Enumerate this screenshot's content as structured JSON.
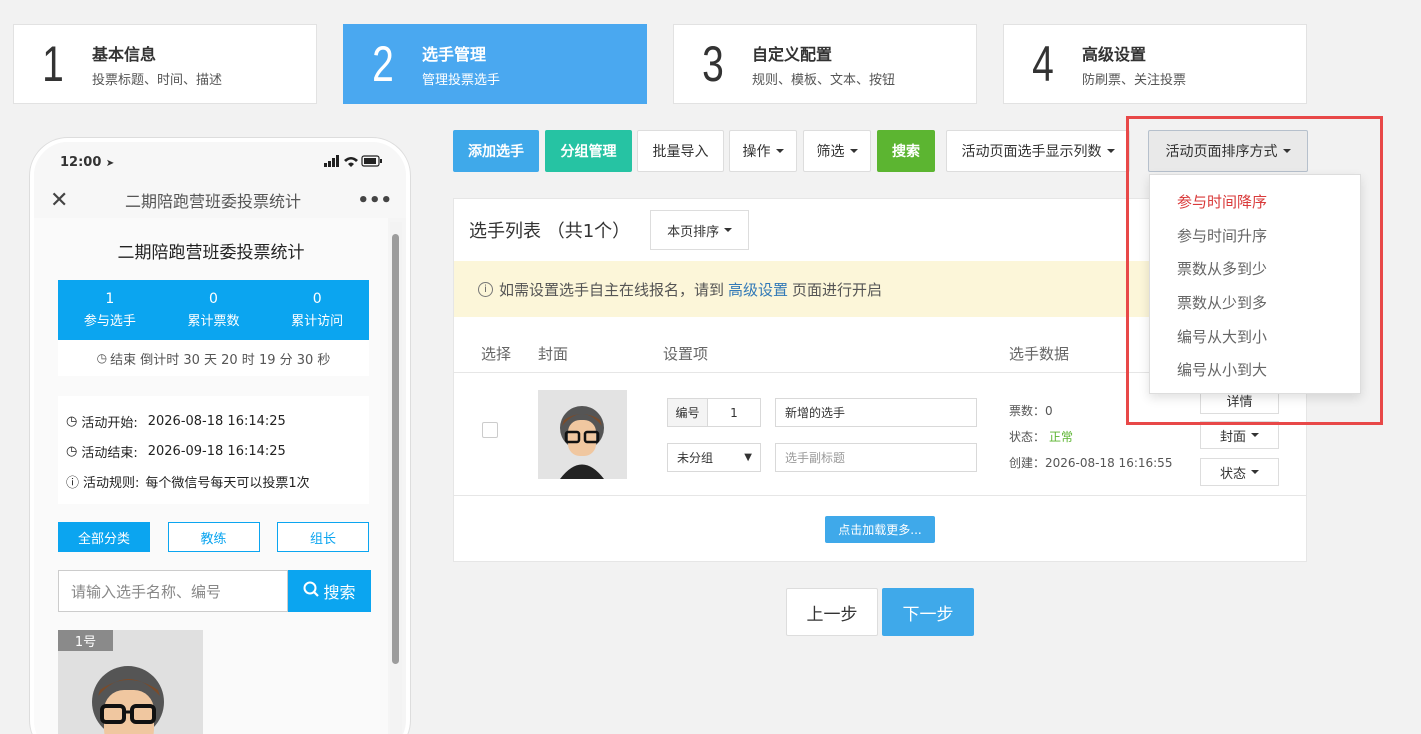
{
  "steps": [
    {
      "num": "1",
      "title": "基本信息",
      "sub": "投票标题、时间、描述"
    },
    {
      "num": "2",
      "title": "选手管理",
      "sub": "管理投票选手"
    },
    {
      "num": "3",
      "title": "自定义配置",
      "sub": "规则、模板、文本、按钮"
    },
    {
      "num": "4",
      "title": "高级设置",
      "sub": "防刷票、关注投票"
    }
  ],
  "phone": {
    "time": "12:00",
    "nav_title": "二期陪跑营班委投票统计",
    "page_title": "二期陪跑营班委投票统计",
    "stats": [
      {
        "value": "1",
        "label": "参与选手"
      },
      {
        "value": "0",
        "label": "累计票数"
      },
      {
        "value": "0",
        "label": "累计访问"
      }
    ],
    "countdown": "结束 倒计时 30 天 20 时 19 分 30 秒",
    "info": [
      {
        "label": "活动开始:",
        "value": "2026-08-18 16:14:25"
      },
      {
        "label": "活动结束:",
        "value": "2026-09-18 16:14:25"
      },
      {
        "label": "活动规则:",
        "value": "每个微信号每天可以投票1次"
      }
    ],
    "tabs": [
      "全部分类",
      "教练",
      "组长"
    ],
    "search_placeholder": "请输入选手名称、编号",
    "search_button": "搜索",
    "card_badge": "1号"
  },
  "toolbar": {
    "add": "添加选手",
    "group": "分组管理",
    "import": "批量导入",
    "ops": "操作",
    "filter": "筛选",
    "search": "搜索",
    "columns": "活动页面选手显示列数",
    "sort": "活动页面排序方式"
  },
  "list": {
    "title": "选手列表 （共1个）",
    "page_sort": "本页排序",
    "notice_pre": "如需设置选手自主在线报名，请到",
    "notice_link": "高级设置",
    "notice_post": "页面进行开启",
    "headers": [
      "选择",
      "封面",
      "设置项",
      "选手数据"
    ],
    "row": {
      "num_label": "编号",
      "num_value": "1",
      "name_value": "新增的选手",
      "group_value": "未分组",
      "subtitle_placeholder": "选手副标题",
      "votes": "票数：0",
      "status_label": "状态：",
      "status_value": "正常",
      "created": "创建：2026-08-18 16:16:55",
      "btn_detail": "详情",
      "btn_cover": "封面",
      "btn_status": "状态"
    },
    "load_more": "点击加载更多..."
  },
  "nav": {
    "prev": "上一步",
    "next": "下一步"
  },
  "sort_menu": {
    "options": [
      "参与时间降序",
      "参与时间升序",
      "票数从多到少",
      "票数从少到多",
      "编号从大到小",
      "编号从小到大"
    ],
    "selected_index": 0
  },
  "colors": {
    "primary": "#3fa9ea",
    "teal": "#26c3a3",
    "green": "#5cb531",
    "phone_blue": "#0ba5f0",
    "highlight": "#e84848",
    "status_ok": "#5cb531"
  }
}
